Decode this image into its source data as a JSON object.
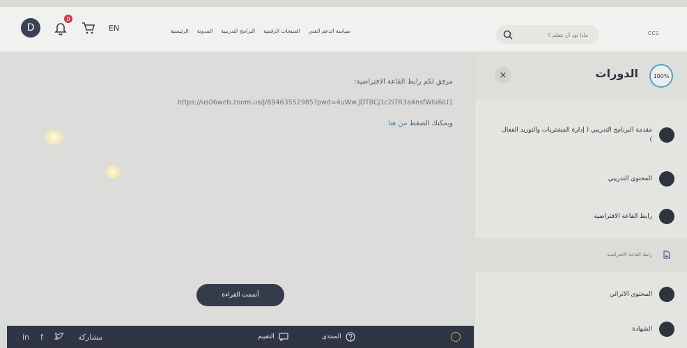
{
  "header": {
    "avatar_initial": "D",
    "notification_count": "0",
    "language": "EN",
    "nav": [
      "الرئيسية",
      "المدونة",
      "البرامج التدريبية",
      "المنتجات الرقمية",
      "سياسة الدعم الفني"
    ],
    "search_placeholder": "ماذا تود أن تتعلم ؟",
    "brand": "CCS"
  },
  "content": {
    "line1": "مرفق لكم رابط القاعة الافتراضية:",
    "url": "https://us06web.zoom.us/j/89463552985?pwd=4uWw.jDTBCj1c2i7R3a4nsfWbi6iU1",
    "line3_prefix": "ويمكنك الضغط",
    "line3_link": "من هنا",
    "done_button": "أتممت القراءة"
  },
  "footer": {
    "share_label": "مشاركة",
    "forum_label": "المنتدى",
    "rating_label": "التقييم"
  },
  "sidebar": {
    "title": "الدورات",
    "progress": "100%",
    "close": "×",
    "items": [
      {
        "label": "مقدمة البرنامج التدريبي ( إدارة المشتريات والتوريد الفعال )",
        "type": "section"
      },
      {
        "label": "المحتوى التدريبي",
        "type": "section"
      },
      {
        "label": "رابط القاعة الافتراضية",
        "type": "section"
      },
      {
        "label": "رابط القاعة الافتراضية",
        "type": "lesson"
      },
      {
        "label": "المحتوى الاثرائي",
        "type": "section"
      },
      {
        "label": "الشهادة",
        "type": "section"
      }
    ]
  },
  "colors": {
    "dark": "#2f3545",
    "progress_ring": "#4aa3c9",
    "badge": "#d7374d",
    "link": "#4a7fc1"
  }
}
